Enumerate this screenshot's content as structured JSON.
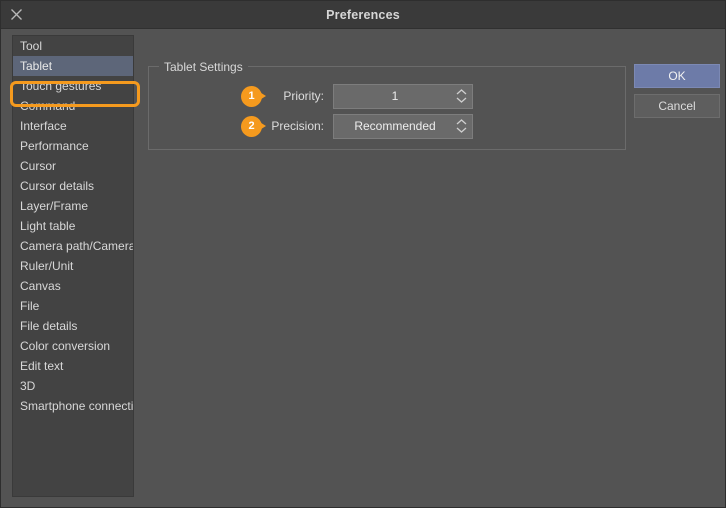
{
  "window": {
    "title": "Preferences",
    "close_icon": "close-icon"
  },
  "sidebar": {
    "items": [
      {
        "label": "Tool",
        "selected": false
      },
      {
        "label": "Tablet",
        "selected": true
      },
      {
        "label": "Touch gestures",
        "selected": false
      },
      {
        "label": "Command",
        "selected": false
      },
      {
        "label": "Interface",
        "selected": false
      },
      {
        "label": "Performance",
        "selected": false
      },
      {
        "label": "Cursor",
        "selected": false
      },
      {
        "label": "Cursor details",
        "selected": false
      },
      {
        "label": "Layer/Frame",
        "selected": false
      },
      {
        "label": "Light table",
        "selected": false
      },
      {
        "label": "Camera path/Camera",
        "selected": false
      },
      {
        "label": "Ruler/Unit",
        "selected": false
      },
      {
        "label": "Canvas",
        "selected": false
      },
      {
        "label": "File",
        "selected": false
      },
      {
        "label": "File details",
        "selected": false
      },
      {
        "label": "Color conversion",
        "selected": false
      },
      {
        "label": "Edit text",
        "selected": false
      },
      {
        "label": "3D",
        "selected": false
      },
      {
        "label": "Smartphone connection",
        "selected": false
      }
    ]
  },
  "main": {
    "group_title": "Tablet Settings",
    "fields": [
      {
        "badge": "1",
        "label": "Priority:",
        "value": "1",
        "stepper_icon": "chevron-up-down-icon"
      },
      {
        "badge": "2",
        "label": "Precision:",
        "value": "Recommended",
        "stepper_icon": "chevron-up-down-icon"
      }
    ]
  },
  "buttons": {
    "ok": "OK",
    "cancel": "Cancel"
  },
  "colors": {
    "accent_orange": "#f59a1e",
    "ok_blue": "#6d7ba8",
    "selection_blue": "#5d6679",
    "dialog_bg": "#535353",
    "titlebar_bg": "#3a3a3a",
    "sidebar_bg": "#434343",
    "field_bg": "#6a6a6a"
  }
}
